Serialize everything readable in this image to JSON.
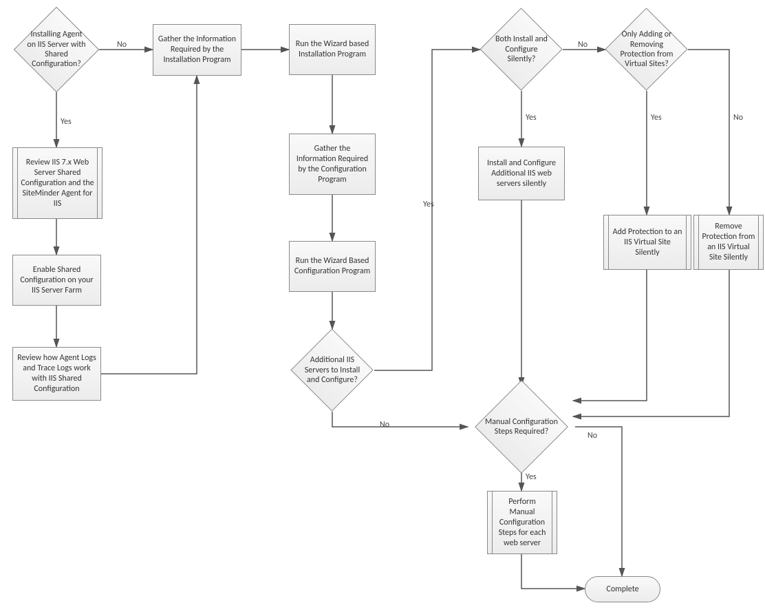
{
  "chart_data": {
    "type": "flowchart",
    "nodes": [
      {
        "id": "d1",
        "type": "decision",
        "text": "Installing Agent on IIS Server with Shared Configuration?"
      },
      {
        "id": "p1",
        "type": "process",
        "text": "Gather the Information Required by the Installation Program"
      },
      {
        "id": "p2",
        "type": "process",
        "text": "Run the Wizard based Installation Program"
      },
      {
        "id": "s1",
        "type": "subprocess",
        "text": "Review IIS 7.x Web Server Shared Configuration and the SiteMinder Agent for IIS"
      },
      {
        "id": "p3",
        "type": "process",
        "text": "Enable Shared Configuration on your IIS Server Farm"
      },
      {
        "id": "p4",
        "type": "process",
        "text": "Review how Agent Logs and Trace Logs work with IIS Shared Configuration"
      },
      {
        "id": "p5",
        "type": "process",
        "text": "Gather the Information Required by the Configuration Program"
      },
      {
        "id": "p6",
        "type": "process",
        "text": "Run the Wizard Based Configuration Program"
      },
      {
        "id": "d2",
        "type": "decision",
        "text": "Additional IIS Servers to Install and Configure?"
      },
      {
        "id": "d3",
        "type": "decision",
        "text": "Both Install and Configure Silently?"
      },
      {
        "id": "d4",
        "type": "decision",
        "text": "Only Adding or Removing Protection from Virtual Sites?"
      },
      {
        "id": "p7",
        "type": "process",
        "text": "Install and Configure Additional IIS web servers silently"
      },
      {
        "id": "s2",
        "type": "subprocess",
        "text": "Add Protection to an IIS Virtual Site Silently"
      },
      {
        "id": "s3",
        "type": "subprocess",
        "text": "Remove Protection from an IIS Virtual Site Silently"
      },
      {
        "id": "d5",
        "type": "decision",
        "text": "Manual Configuration Steps Required?"
      },
      {
        "id": "s4",
        "type": "subprocess",
        "text": "Perform Manual Configuration Steps for each web server"
      },
      {
        "id": "t1",
        "type": "terminator",
        "text": "Complete"
      }
    ],
    "edges": [
      {
        "from": "d1",
        "to": "p1",
        "label": "No"
      },
      {
        "from": "d1",
        "to": "s1",
        "label": "Yes"
      },
      {
        "from": "s1",
        "to": "p3",
        "label": ""
      },
      {
        "from": "p3",
        "to": "p4",
        "label": ""
      },
      {
        "from": "p4",
        "to": "p1",
        "label": ""
      },
      {
        "from": "p1",
        "to": "p2",
        "label": ""
      },
      {
        "from": "p2",
        "to": "p5",
        "label": ""
      },
      {
        "from": "p5",
        "to": "p6",
        "label": ""
      },
      {
        "from": "p6",
        "to": "d2",
        "label": ""
      },
      {
        "from": "d2",
        "to": "d3",
        "label": "Yes"
      },
      {
        "from": "d2",
        "to": "d5",
        "label": "No"
      },
      {
        "from": "d3",
        "to": "p7",
        "label": "Yes"
      },
      {
        "from": "d3",
        "to": "d4",
        "label": "No"
      },
      {
        "from": "d4",
        "to": "s2",
        "label": "Yes"
      },
      {
        "from": "d4",
        "to": "s3",
        "label": "No"
      },
      {
        "from": "p7",
        "to": "d5",
        "label": ""
      },
      {
        "from": "s2",
        "to": "d5",
        "label": ""
      },
      {
        "from": "s3",
        "to": "d5",
        "label": ""
      },
      {
        "from": "d5",
        "to": "s4",
        "label": "Yes"
      },
      {
        "from": "d5",
        "to": "t1",
        "label": "No"
      },
      {
        "from": "s4",
        "to": "t1",
        "label": ""
      }
    ],
    "edge_labels": {
      "yes": "Yes",
      "no": "No"
    }
  }
}
